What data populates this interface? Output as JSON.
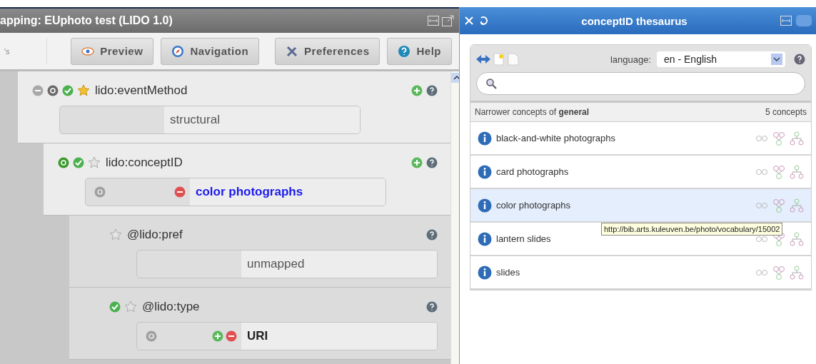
{
  "mapping_window": {
    "title": "apping: EUphoto test (LIDO 1.0)",
    "toolbar_cut_text": "'s",
    "toolbar_buttons": [
      {
        "kind": "preview",
        "label": "Preview"
      },
      {
        "kind": "navigation",
        "label": "Navigation"
      },
      {
        "kind": "preferences",
        "label": "Preferences"
      },
      {
        "kind": "help",
        "label": "Help"
      }
    ]
  },
  "tree": [
    {
      "name": "lido:eventMethod",
      "icons": [
        {
          "kind": "remove"
        },
        {
          "kind": "sub"
        },
        {
          "kind": "check"
        },
        {
          "kind": "star",
          "selected": true
        }
      ],
      "actions": [
        {
          "kind": "add"
        },
        {
          "kind": "help"
        }
      ],
      "value": {
        "text": "structural",
        "kind": "plain"
      },
      "children": [
        {
          "name": "lido:conceptID",
          "icons": [
            {
              "kind": "sub_green"
            },
            {
              "kind": "check"
            },
            {
              "kind": "star",
              "selected": false
            }
          ],
          "actions": [
            {
              "kind": "add"
            },
            {
              "kind": "help"
            }
          ],
          "value": {
            "text": "color photographs",
            "kind": "concept",
            "icons": [
              {
                "kind": "index"
              },
              {
                "kind": "remove_red"
              }
            ]
          },
          "children": [
            {
              "name": "@lido:pref",
              "icons": [
                {
                  "kind": "star",
                  "selected": false
                }
              ],
              "actions": [
                {
                  "kind": "help"
                }
              ],
              "value": {
                "text": "unmapped",
                "kind": "plain"
              }
            },
            {
              "name": "@lido:type",
              "icons": [
                {
                  "kind": "check"
                },
                {
                  "kind": "star",
                  "selected": false
                }
              ],
              "actions": [
                {
                  "kind": "help"
                }
              ],
              "value": {
                "text": "URI",
                "kind": "bold",
                "icons": [
                  {
                    "kind": "index"
                  },
                  {
                    "kind": "add"
                  },
                  {
                    "kind": "remove_red"
                  }
                ]
              }
            }
          ]
        }
      ]
    }
  ],
  "thesaurus": {
    "title": "conceptID thesaurus",
    "language_label": "language:",
    "language_value": "en - English",
    "results_heading": "Narrower concepts of **general**",
    "results_count": "5 concepts",
    "concepts": [
      {
        "label": "black-and-white photographs",
        "selected": false
      },
      {
        "label": "card photographs",
        "selected": false
      },
      {
        "label": "color photographs",
        "selected": true
      },
      {
        "label": "lantern slides",
        "selected": false
      },
      {
        "label": "slides",
        "selected": false
      }
    ],
    "tooltip": "http://bib.arts.kuleuven.be/photo/vocabulary/15002"
  }
}
